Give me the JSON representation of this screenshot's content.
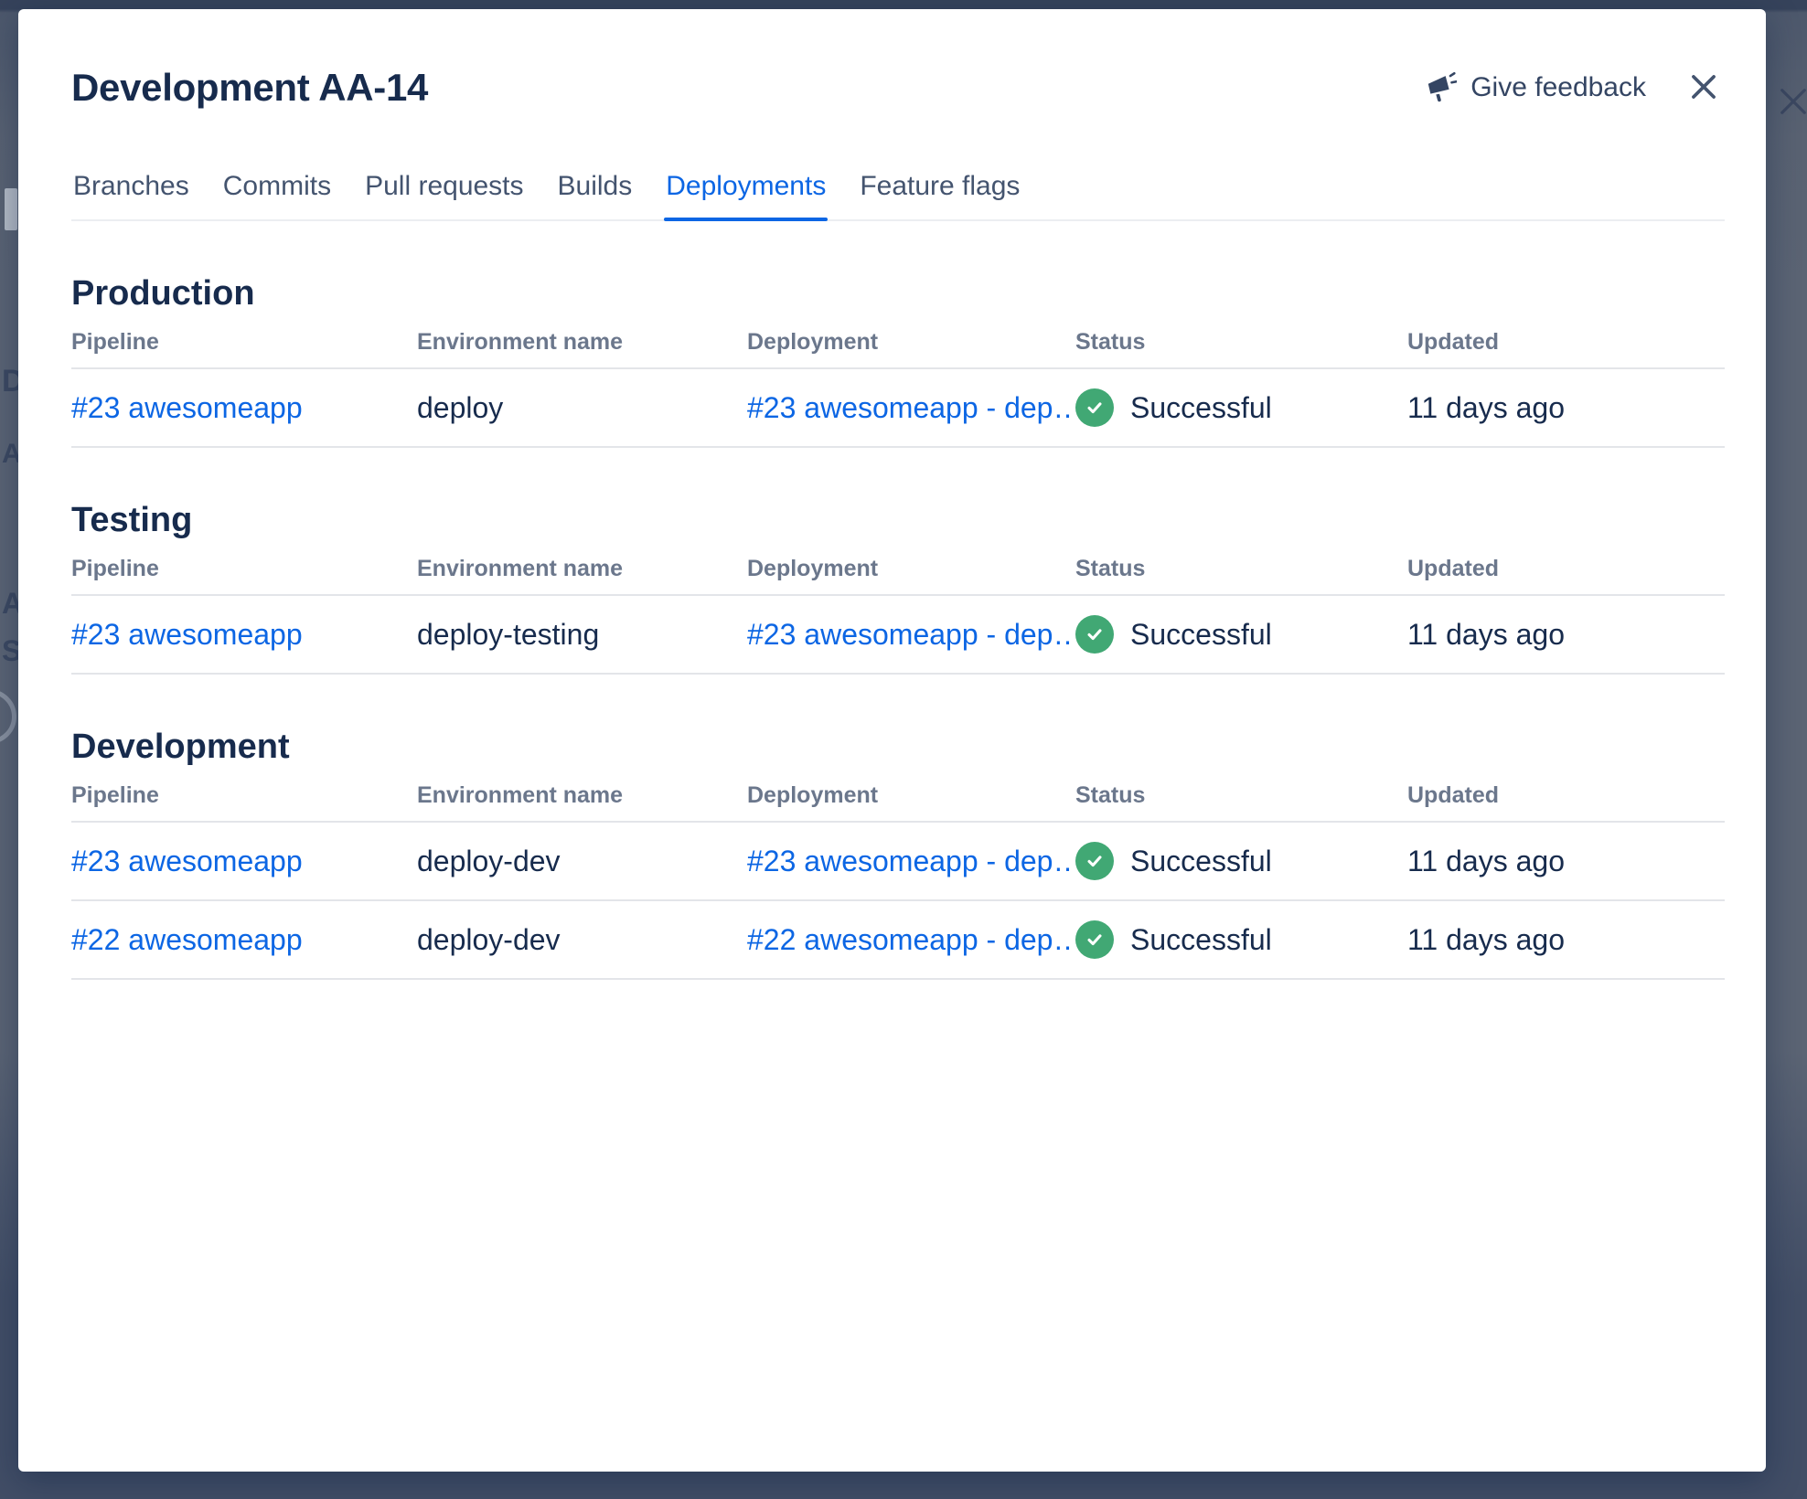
{
  "modal": {
    "title": "Development AA-14",
    "feedback_label": "Give feedback",
    "tabs": [
      {
        "label": "Branches"
      },
      {
        "label": "Commits"
      },
      {
        "label": "Pull requests"
      },
      {
        "label": "Builds"
      },
      {
        "label": "Deployments"
      },
      {
        "label": "Feature flags"
      }
    ]
  },
  "table_columns": [
    "Pipeline",
    "Environment name",
    "Deployment",
    "Status",
    "Updated"
  ],
  "sections": [
    {
      "heading": "Production",
      "rows": [
        {
          "pipeline": "#23 awesomeapp",
          "environment": "deploy",
          "deployment": "#23 awesomeapp - dep…",
          "status": "Successful",
          "updated": "11 days ago"
        }
      ]
    },
    {
      "heading": "Testing",
      "rows": [
        {
          "pipeline": "#23 awesomeapp",
          "environment": "deploy-testing",
          "deployment": "#23 awesomeapp - dep…",
          "status": "Successful",
          "updated": "11 days ago"
        }
      ]
    },
    {
      "heading": "Development",
      "rows": [
        {
          "pipeline": "#23 awesomeapp",
          "environment": "deploy-dev",
          "deployment": "#23 awesomeapp - dep…",
          "status": "Successful",
          "updated": "11 days ago"
        },
        {
          "pipeline": "#22 awesomeapp",
          "environment": "deploy-dev",
          "deployment": "#22 awesomeapp - dep…",
          "status": "Successful",
          "updated": "11 days ago"
        }
      ]
    }
  ],
  "background": {
    "partial_letters": [
      "D",
      "A",
      "A",
      "S"
    ]
  },
  "colors": {
    "link_blue": "#0c66e4",
    "active_tab_blue": "#0c66e4",
    "success_green": "#41a874",
    "title_text": "#172b4d",
    "muted_header_text": "#6b778c"
  }
}
